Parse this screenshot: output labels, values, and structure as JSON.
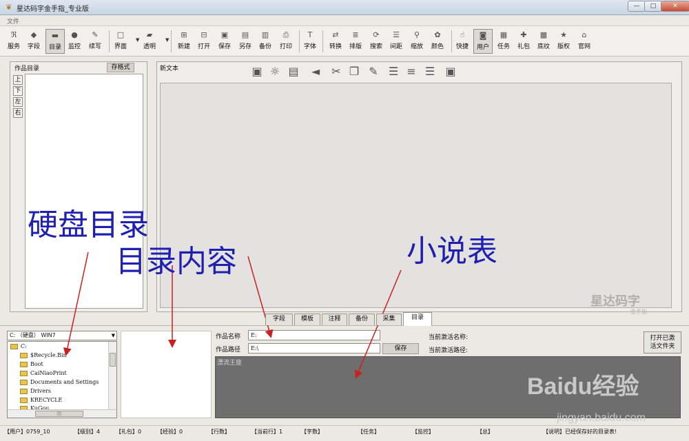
{
  "window": {
    "title": "星达码字金手指_专业版",
    "minimize": "—",
    "restore": "□",
    "close": "✕"
  },
  "menu": {
    "file": "文件"
  },
  "toolbar": {
    "items": [
      {
        "label": "服务",
        "icon": "rss-icon"
      },
      {
        "label": "字段",
        "icon": "diamond-icon"
      },
      {
        "label": "目录",
        "icon": "folder-icon"
      },
      {
        "label": "监控",
        "icon": "globe-icon"
      },
      {
        "label": "续写",
        "icon": "pen-icon"
      },
      {
        "label": "界面",
        "icon": "window-icon"
      },
      {
        "label": "透明",
        "icon": "image-icon"
      },
      {
        "label": "新建",
        "icon": "new-icon"
      },
      {
        "label": "打开",
        "icon": "open-icon"
      },
      {
        "label": "保存",
        "icon": "save-icon"
      },
      {
        "label": "另存",
        "icon": "save-as-icon"
      },
      {
        "label": "备份",
        "icon": "backup-icon"
      },
      {
        "label": "打印",
        "icon": "print-icon"
      },
      {
        "label": "字体",
        "icon": "font-icon"
      },
      {
        "label": "转换",
        "icon": "convert-icon"
      },
      {
        "label": "排版",
        "icon": "layout-icon"
      },
      {
        "label": "搜索",
        "icon": "refresh-search-icon"
      },
      {
        "label": "间距",
        "icon": "spacing-icon"
      },
      {
        "label": "缩放",
        "icon": "zoom-icon"
      },
      {
        "label": "颜色",
        "icon": "palette-icon"
      },
      {
        "label": "快捷",
        "icon": "shortcut-icon"
      },
      {
        "label": "用户",
        "icon": "user-icon"
      },
      {
        "label": "任务",
        "icon": "task-icon"
      },
      {
        "label": "礼包",
        "icon": "gift-icon"
      },
      {
        "label": "底纹",
        "icon": "texture-icon"
      },
      {
        "label": "版权",
        "icon": "star-icon"
      },
      {
        "label": "官网",
        "icon": "home-icon"
      }
    ]
  },
  "left_panel": {
    "title": "作品目录",
    "save_format": "存格式",
    "move_buttons": [
      "上",
      "下",
      "左",
      "右"
    ]
  },
  "editor": {
    "title": "新文本",
    "icons": [
      "save-icon",
      "bulb-icon",
      "document-icon",
      "back-arrow-icon",
      "scissors-icon",
      "copy-icon",
      "edit-icon",
      "align-left-icon",
      "align-center-icon",
      "align-right-icon",
      "fullscreen-icon"
    ],
    "watermark": "星达码字",
    "watermark_sub": "金手指"
  },
  "tabs": [
    "字段",
    "模板",
    "注释",
    "备份",
    "采集",
    "目录"
  ],
  "active_tab": "目录",
  "bottom": {
    "drive_select": "C: （硬盘） WIN7",
    "tree": [
      "C:",
      "$Recycle.Bin",
      "Boot",
      "CaiNiaoPrint",
      "Documents and Settings",
      "Drivers",
      "KRECYCLE",
      "KuGou"
    ],
    "work_name_label": "作品名称",
    "work_name_value": "E:",
    "work_path_label": "作品路径",
    "work_path_value": "E:\\",
    "save_button": "保存",
    "active_name_label": "当前激活名称:",
    "active_path_label": "当前激活路径:",
    "open_activated_line1": "打开已激",
    "open_activated_line2": "活文件夹",
    "novel_table_rows": [
      "漂流王座"
    ]
  },
  "statusbar": {
    "items": [
      "【用户】0759_10",
      "【级别】4",
      "【礼包】0",
      "【经验】0",
      "【行数】",
      "【当前行】1",
      "【字数】",
      "【任务】",
      "【监控】",
      "【总】",
      "【说明】已经保存好的目录表!"
    ]
  },
  "annotations": {
    "disk_directory": "硬盘目录",
    "directory_contents": "目录内容",
    "novel_table": "小说表"
  },
  "source_watermark": {
    "brand": "Baidu经验",
    "url": "jingyan.baidu.com"
  },
  "colors": {
    "annotation": "#1f1fb0",
    "arrow": "#cc1f1f",
    "novel_table_bg": "#6e6e6e"
  }
}
